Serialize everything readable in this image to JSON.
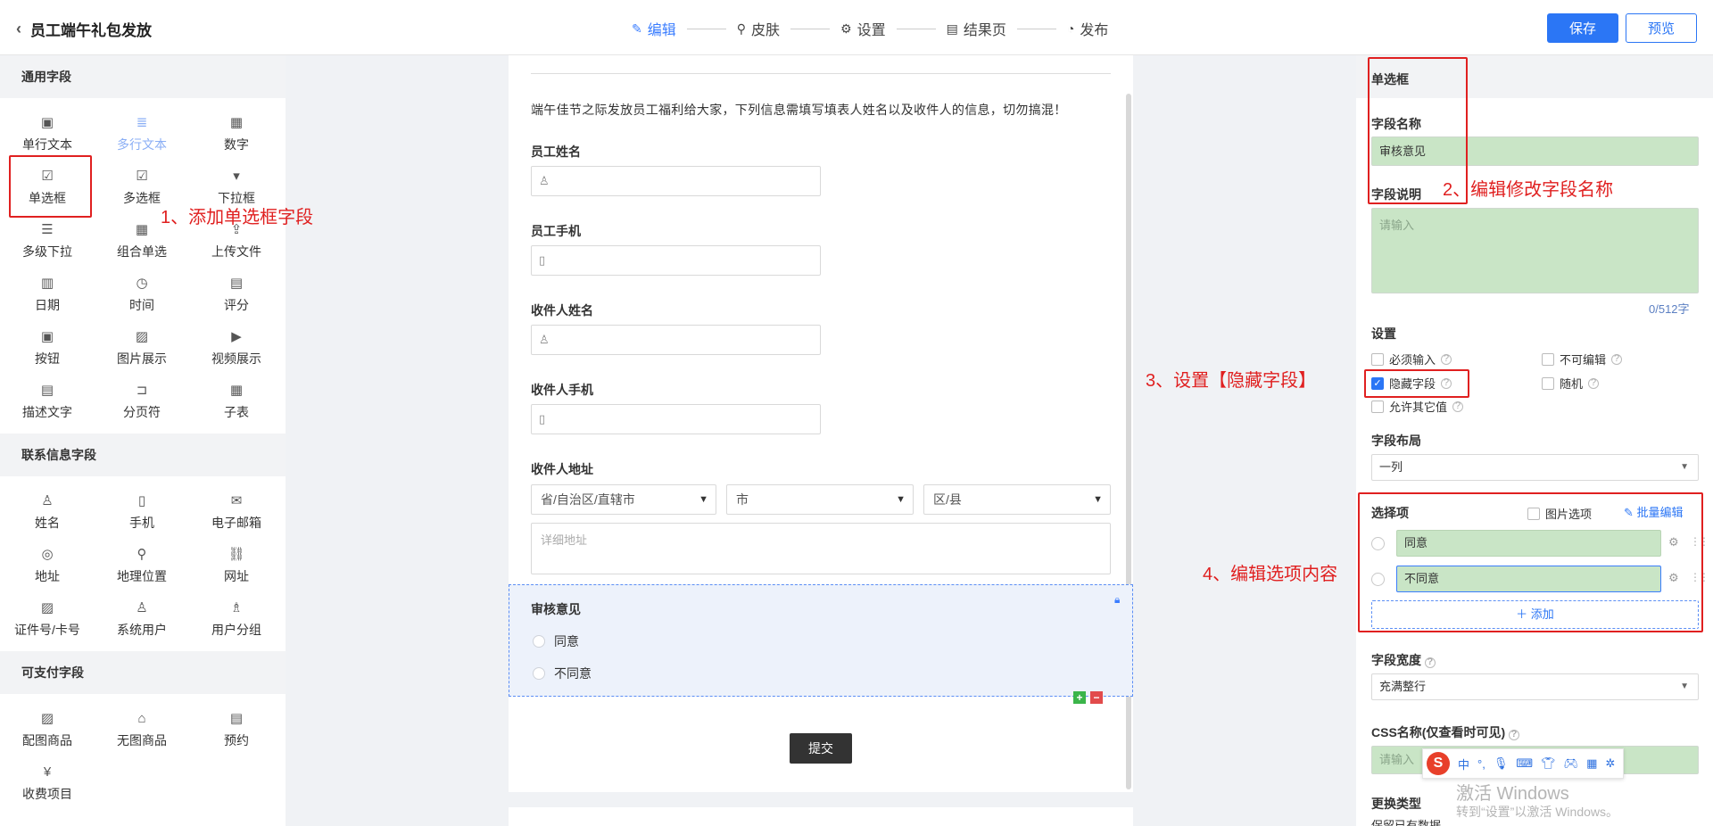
{
  "header": {
    "back_title": "员工端午礼包发放",
    "steps": [
      "编辑",
      "皮肤",
      "设置",
      "结果页",
      "发布"
    ],
    "save_label": "保存",
    "preview_label": "预览"
  },
  "left": {
    "sections": [
      {
        "title": "通用字段",
        "items": [
          "单行文本",
          "多行文本",
          "数字",
          "单选框",
          "多选框",
          "下拉框",
          "多级下拉",
          "组合单选",
          "上传文件",
          "日期",
          "时间",
          "评分",
          "按钮",
          "图片展示",
          "视频展示",
          "描述文字",
          "分页符",
          "子表"
        ]
      },
      {
        "title": "联系信息字段",
        "items": [
          "姓名",
          "手机",
          "电子邮箱",
          "地址",
          "地理位置",
          "网址",
          "证件号/卡号",
          "系统用户",
          "用户分组"
        ]
      },
      {
        "title": "可支付字段",
        "items": [
          "配图商品",
          "无图商品",
          "预约",
          "收费项目"
        ]
      }
    ]
  },
  "form": {
    "description": "端午佳节之际发放员工福利给大家，下列信息需填写填表人姓名以及收件人的信息，切勿搞混！",
    "fields": [
      "员工姓名",
      "员工手机",
      "收件人姓名",
      "收件人手机",
      "收件人地址"
    ],
    "address": {
      "province": "省/自治区/直辖市",
      "city": "市",
      "district": "区/县",
      "detail_placeholder": "详细地址"
    },
    "selected_field": {
      "title": "审核意见",
      "options": [
        "同意",
        "不同意"
      ]
    },
    "submit_label": "提交"
  },
  "right": {
    "panel_title": "单选框",
    "name_label": "字段名称",
    "name_value": "审核意见",
    "desc_label": "字段说明",
    "desc_placeholder": "请输入",
    "counter": "0/512字",
    "settings_label": "设置",
    "settings": {
      "required": "必须输入",
      "readonly": "不可编辑",
      "hidden": "隐藏字段",
      "random": "随机",
      "allow_other": "允许其它值"
    },
    "layout_label": "字段布局",
    "layout_value": "一列",
    "options_label": "选择项",
    "image_option": "图片选项",
    "batch_edit": "批量编辑",
    "options": [
      "同意",
      "不同意"
    ],
    "add_label": "添加",
    "width_label": "字段宽度",
    "width_value": "充满整行",
    "css_label": "CSS名称(仅查看时可见)",
    "css_placeholder": "请输入",
    "more_label": "更换类型",
    "more_sub": "保留已有数据"
  },
  "annotations": {
    "a1": "1、添加单选框字段",
    "a2": "2、编辑修改字段名称",
    "a3": "3、设置【隐藏字段】",
    "a4": "4、编辑选项内容"
  },
  "ime": {
    "lang": "中"
  },
  "watermark": {
    "line1": "激活 Windows",
    "line2": "转到“设置”以激活 Windows。"
  },
  "colors": {
    "accent": "#2b76f5",
    "annotation": "#e02020",
    "field_fill": "#c9e5c6"
  }
}
